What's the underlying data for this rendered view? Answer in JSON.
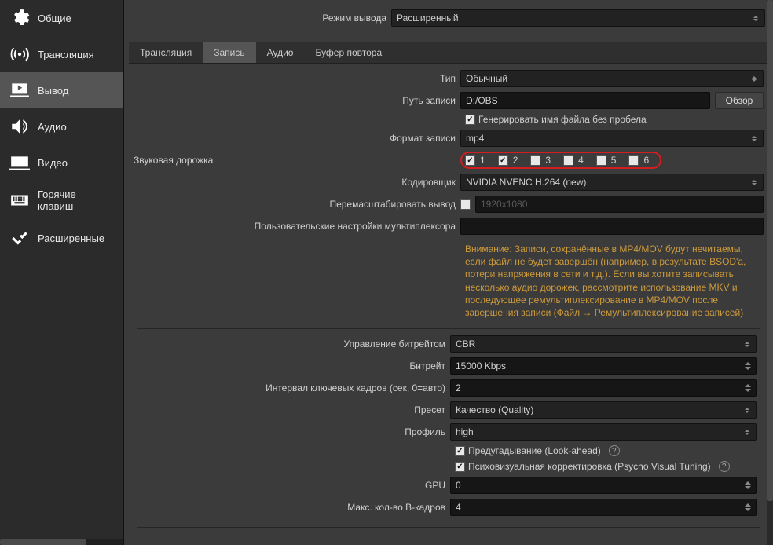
{
  "sidebar": {
    "items": [
      {
        "label": "Общие"
      },
      {
        "label": "Трансляция"
      },
      {
        "label": "Вывод"
      },
      {
        "label": "Аудио"
      },
      {
        "label": "Видео"
      },
      {
        "label": "Горячие клавиш"
      },
      {
        "label": "Расширенные"
      }
    ]
  },
  "output_mode": {
    "label": "Режим вывода",
    "value": "Расширенный"
  },
  "tabs": [
    {
      "label": "Трансляция"
    },
    {
      "label": "Запись"
    },
    {
      "label": "Аудио"
    },
    {
      "label": "Буфер повтора"
    }
  ],
  "rec": {
    "type_label": "Тип",
    "type_value": "Обычный",
    "path_label": "Путь записи",
    "path_value": "D:/OBS",
    "browse": "Обзор",
    "gen_label": "Генерировать имя файла без пробела",
    "format_label": "Формат записи",
    "format_value": "mp4",
    "tracks_label": "Звуковая дорожка",
    "tracks": [
      {
        "n": "1",
        "c": true
      },
      {
        "n": "2",
        "c": true
      },
      {
        "n": "3",
        "c": false
      },
      {
        "n": "4",
        "c": false
      },
      {
        "n": "5",
        "c": false
      },
      {
        "n": "6",
        "c": false
      }
    ],
    "encoder_label": "Кодировщик",
    "encoder_value": "NVIDIA NVENC H.264 (new)",
    "rescale_label": "Перемасштабировать вывод",
    "rescale_placeholder": "1920x1080",
    "mux_label": "Пользовательские настройки мультиплексора",
    "warning": "Внимание: Записи, сохранённые в MP4/MOV будут нечитаемы, если файл не будет завершён (например, в результате BSOD'а, потери напряжения в сети и т.д.). Если вы хотите записывать несколько аудио дорожек, рассмотрите использование MKV и последующее ремультиплексирование в MP4/MOV после завершения записи (Файл → Ремультиплексирование записей)"
  },
  "enc": {
    "rate_label": "Управление битрейтом",
    "rate_value": "CBR",
    "bitrate_label": "Битрейт",
    "bitrate_value": "15000 Kbps",
    "keyint_label": "Интервал ключевых кадров (сек, 0=авто)",
    "keyint_value": "2",
    "preset_label": "Пресет",
    "preset_value": "Качество (Quality)",
    "profile_label": "Профиль",
    "profile_value": "high",
    "lookahead_label": "Предугадывание (Look-ahead)",
    "psy_label": "Психовизуальная корректировка (Psycho Visual Tuning)",
    "gpu_label": "GPU",
    "gpu_value": "0",
    "bframes_label": "Макс. кол-во B-кадров",
    "bframes_value": "4"
  }
}
